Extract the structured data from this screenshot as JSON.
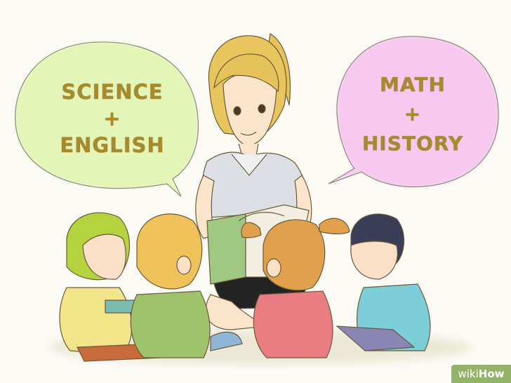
{
  "bubbles": {
    "left": {
      "line1": "SCIENCE",
      "plus": "+",
      "line2": "ENGLISH",
      "color": "#e4f5b8"
    },
    "right": {
      "line1": "MATH",
      "plus": "+",
      "line2": "HISTORY",
      "color": "#f7c9f0"
    }
  },
  "text_color": "#a88a2c",
  "watermark": {
    "prefix": "wiki",
    "suffix": "How",
    "color": "#93b26a"
  }
}
